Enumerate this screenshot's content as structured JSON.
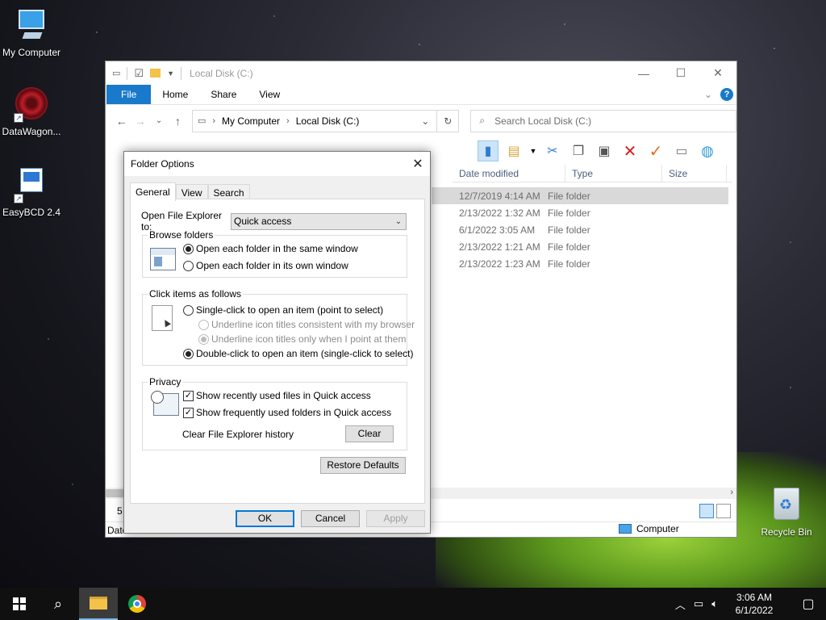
{
  "desktop": {
    "icons": [
      {
        "label": "My Computer"
      },
      {
        "label": "DataWagon..."
      },
      {
        "label": "EasyBCD 2.4"
      },
      {
        "label": "Recycle Bin"
      }
    ]
  },
  "explorer": {
    "title": "Local Disk (C:)",
    "ribbon_tabs": [
      "File",
      "Home",
      "Share",
      "View"
    ],
    "help": "?",
    "breadcrumb": [
      "My Computer",
      "Local Disk (C:)"
    ],
    "search_placeholder": "Search Local Disk (C:)",
    "columns": [
      "Date modified",
      "Type",
      "Size"
    ],
    "rows": [
      {
        "date": "12/7/2019 4:14 AM",
        "type": "File folder",
        "selected": true
      },
      {
        "date": "2/13/2022 1:32 AM",
        "type": "File folder"
      },
      {
        "date": "6/1/2022 3:05 AM",
        "type": "File folder"
      },
      {
        "date": "2/13/2022 1:21 AM",
        "type": "File folder"
      },
      {
        "date": "2/13/2022 1:23 AM",
        "type": "File folder"
      }
    ],
    "status_left_partial": "5",
    "status_left_label": "Date",
    "status_right": "Computer"
  },
  "dialog": {
    "title": "Folder Options",
    "tabs": [
      "General",
      "View",
      "Search"
    ],
    "open_explorer_label": "Open File Explorer to:",
    "open_explorer_value": "Quick access",
    "browse_group": "Browse folders",
    "browse_same": "Open each folder in the same window",
    "browse_own": "Open each folder in its own window",
    "click_group": "Click items as follows",
    "single_click": "Single-click to open an item (point to select)",
    "underline_consistent": "Underline icon titles consistent with my browser",
    "underline_point": "Underline icon titles only when I point at them",
    "double_click": "Double-click to open an item (single-click to select)",
    "privacy_group": "Privacy",
    "recent_files": "Show recently used files in Quick access",
    "frequent_folders": "Show frequently used folders in Quick access",
    "clear_history_label": "Clear File Explorer history",
    "clear_button": "Clear",
    "restore_button": "Restore Defaults",
    "ok_button": "OK",
    "cancel_button": "Cancel",
    "apply_button": "Apply"
  },
  "taskbar": {
    "time": "3:06 AM",
    "date": "6/1/2022"
  }
}
